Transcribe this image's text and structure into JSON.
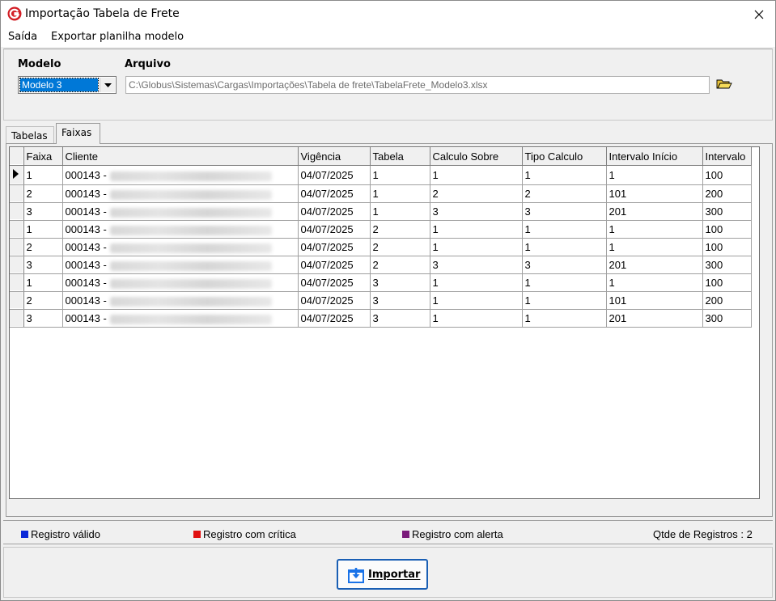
{
  "window": {
    "title": "Importação Tabela de Frete"
  },
  "menu": {
    "items": [
      "Saída",
      "Exportar planilha modelo"
    ]
  },
  "form": {
    "modelo_label": "Modelo",
    "modelo_value": "Modelo 3",
    "arquivo_label": "Arquivo",
    "arquivo_value": "C:\\Globus\\Sistemas\\Cargas\\Importações\\Tabela de frete\\TabelaFrete_Modelo3.xlsx"
  },
  "tabs": [
    {
      "label": "Tabelas",
      "active": false
    },
    {
      "label": "Faixas",
      "active": true
    }
  ],
  "grid": {
    "columns": [
      "Faixa",
      "Cliente",
      "Vigência",
      "Tabela",
      "Calculo Sobre",
      "Tipo Calculo",
      "Intervalo Início",
      "Intervalo"
    ],
    "rows": [
      {
        "faixa": "1",
        "cliente": "000143 -",
        "vigencia": "04/07/2025",
        "tabela": "1",
        "calculo_sobre": "1",
        "tipo_calculo": "1",
        "intervalo_inicio": "1",
        "intervalo": "100",
        "selected": true
      },
      {
        "faixa": "2",
        "cliente": "000143 -",
        "vigencia": "04/07/2025",
        "tabela": "1",
        "calculo_sobre": "2",
        "tipo_calculo": "2",
        "intervalo_inicio": "101",
        "intervalo": "200"
      },
      {
        "faixa": "3",
        "cliente": "000143 -",
        "vigencia": "04/07/2025",
        "tabela": "1",
        "calculo_sobre": "3",
        "tipo_calculo": "3",
        "intervalo_inicio": "201",
        "intervalo": "300"
      },
      {
        "faixa": "1",
        "cliente": "000143 -",
        "vigencia": "04/07/2025",
        "tabela": "2",
        "calculo_sobre": "1",
        "tipo_calculo": "1",
        "intervalo_inicio": "1",
        "intervalo": "100"
      },
      {
        "faixa": "2",
        "cliente": "000143 -",
        "vigencia": "04/07/2025",
        "tabela": "2",
        "calculo_sobre": "1",
        "tipo_calculo": "1",
        "intervalo_inicio": "1",
        "intervalo": "100"
      },
      {
        "faixa": "3",
        "cliente": "000143 -",
        "vigencia": "04/07/2025",
        "tabela": "2",
        "calculo_sobre": "3",
        "tipo_calculo": "3",
        "intervalo_inicio": "201",
        "intervalo": "300"
      },
      {
        "faixa": "1",
        "cliente": "000143 -",
        "vigencia": "04/07/2025",
        "tabela": "3",
        "calculo_sobre": "1",
        "tipo_calculo": "1",
        "intervalo_inicio": "1",
        "intervalo": "100"
      },
      {
        "faixa": "2",
        "cliente": "000143 -",
        "vigencia": "04/07/2025",
        "tabela": "3",
        "calculo_sobre": "1",
        "tipo_calculo": "1",
        "intervalo_inicio": "101",
        "intervalo": "200"
      },
      {
        "faixa": "3",
        "cliente": "000143 -",
        "vigencia": "04/07/2025",
        "tabela": "3",
        "calculo_sobre": "1",
        "tipo_calculo": "1",
        "intervalo_inicio": "201",
        "intervalo": "300"
      }
    ]
  },
  "legend": [
    {
      "label": "Registro válido",
      "color": "#0a28d8"
    },
    {
      "label": "Registro com crítica",
      "color": "#e01010"
    },
    {
      "label": "Registro com alerta",
      "color": "#7a1a7a"
    }
  ],
  "status": {
    "count_text": "Qtde de Registros : 2"
  },
  "actions": {
    "import_label": "Importar"
  },
  "icons": {
    "app": "globus-logo-icon",
    "close": "close-icon",
    "folder": "open-folder-icon",
    "dropdown": "chevron-down-icon",
    "import": "import-download-icon",
    "row_pointer": "row-pointer-icon"
  }
}
